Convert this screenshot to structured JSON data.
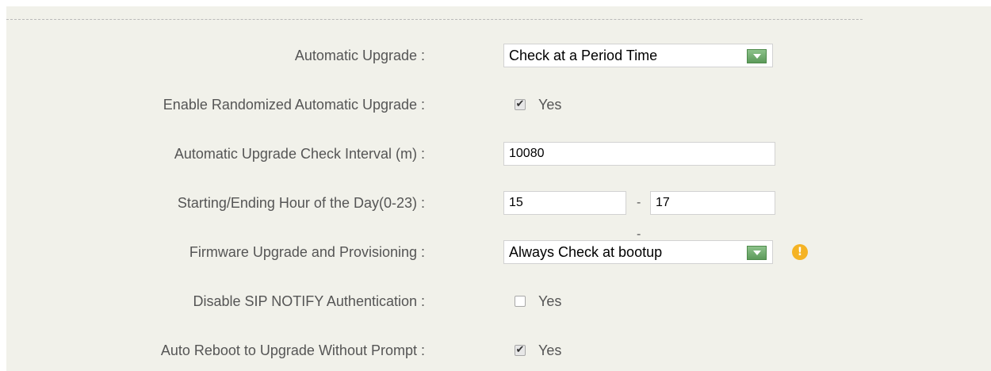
{
  "rows": [
    {
      "label": "Automatic Upgrade :",
      "select_value": "Check at a Period Time"
    },
    {
      "label": "Enable Randomized Automatic Upgrade :",
      "checkbox_label": "Yes",
      "checked": true
    },
    {
      "label": "Automatic Upgrade Check Interval (m) :",
      "input_value": "10080"
    },
    {
      "label": "Starting/Ending Hour of the Day(0-23) :",
      "start_value": "15",
      "separator": "--",
      "end_value": "17"
    },
    {
      "label": "Firmware Upgrade and Provisioning :",
      "select_value": "Always Check at bootup",
      "warning_glyph": "!",
      "warning_icon": "exclamation-circle-icon"
    },
    {
      "label": "Disable SIP NOTIFY Authentication :",
      "checkbox_label": "Yes",
      "checked": false
    },
    {
      "label": "Auto Reboot to Upgrade Without Prompt :",
      "checkbox_label": "Yes",
      "checked": true
    }
  ],
  "glyphs": {
    "check": "✔"
  },
  "colors": {
    "panel_bg": "#f1f1ea",
    "label_text": "#555555",
    "dropdown_button": "#6aa868",
    "warning": "#f5b324"
  }
}
